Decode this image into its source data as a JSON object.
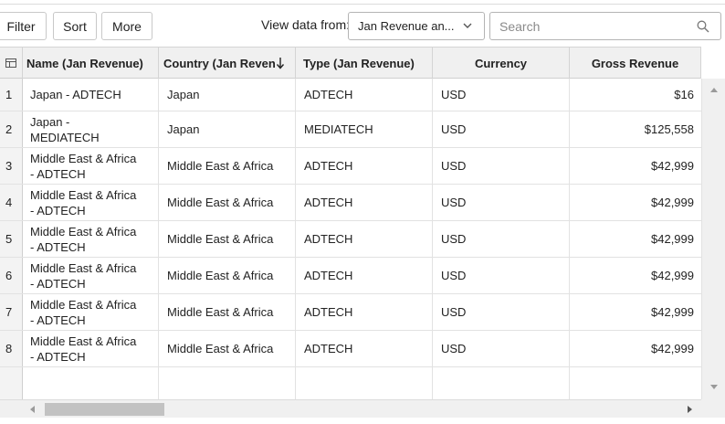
{
  "toolbar": {
    "filter_label": "Filter",
    "sort_label": "Sort",
    "more_label": "More",
    "view_data_label": "View data from:",
    "view_data_value": "Jan Revenue an...",
    "search_placeholder": "Search"
  },
  "table": {
    "columns": [
      "Name (Jan Revenue)",
      "Country (Jan Reven",
      "Type (Jan Revenue)",
      "Currency",
      "Gross Revenue"
    ],
    "rows": [
      {
        "num": "1",
        "name_line1": "Japan - ADTECH",
        "name_line2": "",
        "country": "Japan",
        "type": "ADTECH",
        "currency": "USD",
        "gross": "$16"
      },
      {
        "num": "2",
        "name_line1": "Japan -",
        "name_line2": "MEDIATECH",
        "country": "Japan",
        "type": "MEDIATECH",
        "currency": "USD",
        "gross": "$125,558"
      },
      {
        "num": "3",
        "name_line1": "Middle East & Africa",
        "name_line2": "- ADTECH",
        "country": "Middle East & Africa",
        "type": "ADTECH",
        "currency": "USD",
        "gross": "$42,999"
      },
      {
        "num": "4",
        "name_line1": "Middle East & Africa",
        "name_line2": "- ADTECH",
        "country": "Middle East & Africa",
        "type": "ADTECH",
        "currency": "USD",
        "gross": "$42,999"
      },
      {
        "num": "5",
        "name_line1": "Middle East & Africa",
        "name_line2": "- ADTECH",
        "country": "Middle East & Africa",
        "type": "ADTECH",
        "currency": "USD",
        "gross": "$42,999"
      },
      {
        "num": "6",
        "name_line1": "Middle East & Africa",
        "name_line2": "- ADTECH",
        "country": "Middle East & Africa",
        "type": "ADTECH",
        "currency": "USD",
        "gross": "$42,999"
      },
      {
        "num": "7",
        "name_line1": "Middle East & Africa",
        "name_line2": "- ADTECH",
        "country": "Middle East & Africa",
        "type": "ADTECH",
        "currency": "USD",
        "gross": "$42,999"
      },
      {
        "num": "8",
        "name_line1": "Middle East & Africa",
        "name_line2": "- ADTECH",
        "country": "Middle East & Africa",
        "type": "ADTECH",
        "currency": "USD",
        "gross": "$42,999"
      }
    ],
    "sorted_column_icon": "sort-down-arrow-icon",
    "row_header_icon": "table-layout-icon"
  }
}
